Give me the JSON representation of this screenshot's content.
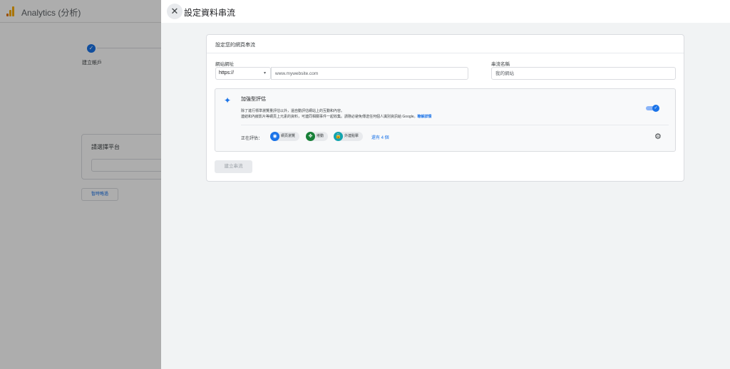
{
  "background_app": {
    "title": "Analytics (分析)",
    "step_label": "建立帳戶",
    "step_check": "✓",
    "platform_card_title": "請選擇平台",
    "skip_label": "暫時略過"
  },
  "dialog": {
    "close_glyph": "✕",
    "title": "設定資料串流",
    "section_heading": "設定您的網頁串流",
    "url_label": "網站網址",
    "protocol_value": "https://",
    "protocol_caret": "▾",
    "url_placeholder": "www.mywebsite.com",
    "stream_name_label": "串流名稱",
    "stream_name_placeholder": "我的網站",
    "enhanced_measurement": {
      "title": "加強型評估",
      "description_line1": "除了進行標準瀏覽量評估以外，還自動評估網站上的互動和內容。",
      "description_line2": "連結和內嵌影片等網頁上元素的資料，可連同相關事件一起收集。請務必避免傳送任何個人識別資訊給 Google。",
      "learn_more": "瞭解詳情",
      "toggle_on": true,
      "measuring_label": "正在評估：",
      "chips": [
        {
          "label": "網頁瀏覽",
          "icon": "eye-icon",
          "glyph": "◉"
        },
        {
          "label": "捲動",
          "icon": "scroll-icon",
          "glyph": "✥"
        },
        {
          "label": "外連點擊",
          "icon": "lock-icon",
          "glyph": "🔒"
        }
      ],
      "more_link": "還有 4 個"
    },
    "create_button": "建立串流"
  },
  "colors": {
    "accent": "#1a73e8",
    "chip_scroll": "#188038",
    "chip_outbound": "#12a4af",
    "logo_orange": "#f9ab00"
  }
}
